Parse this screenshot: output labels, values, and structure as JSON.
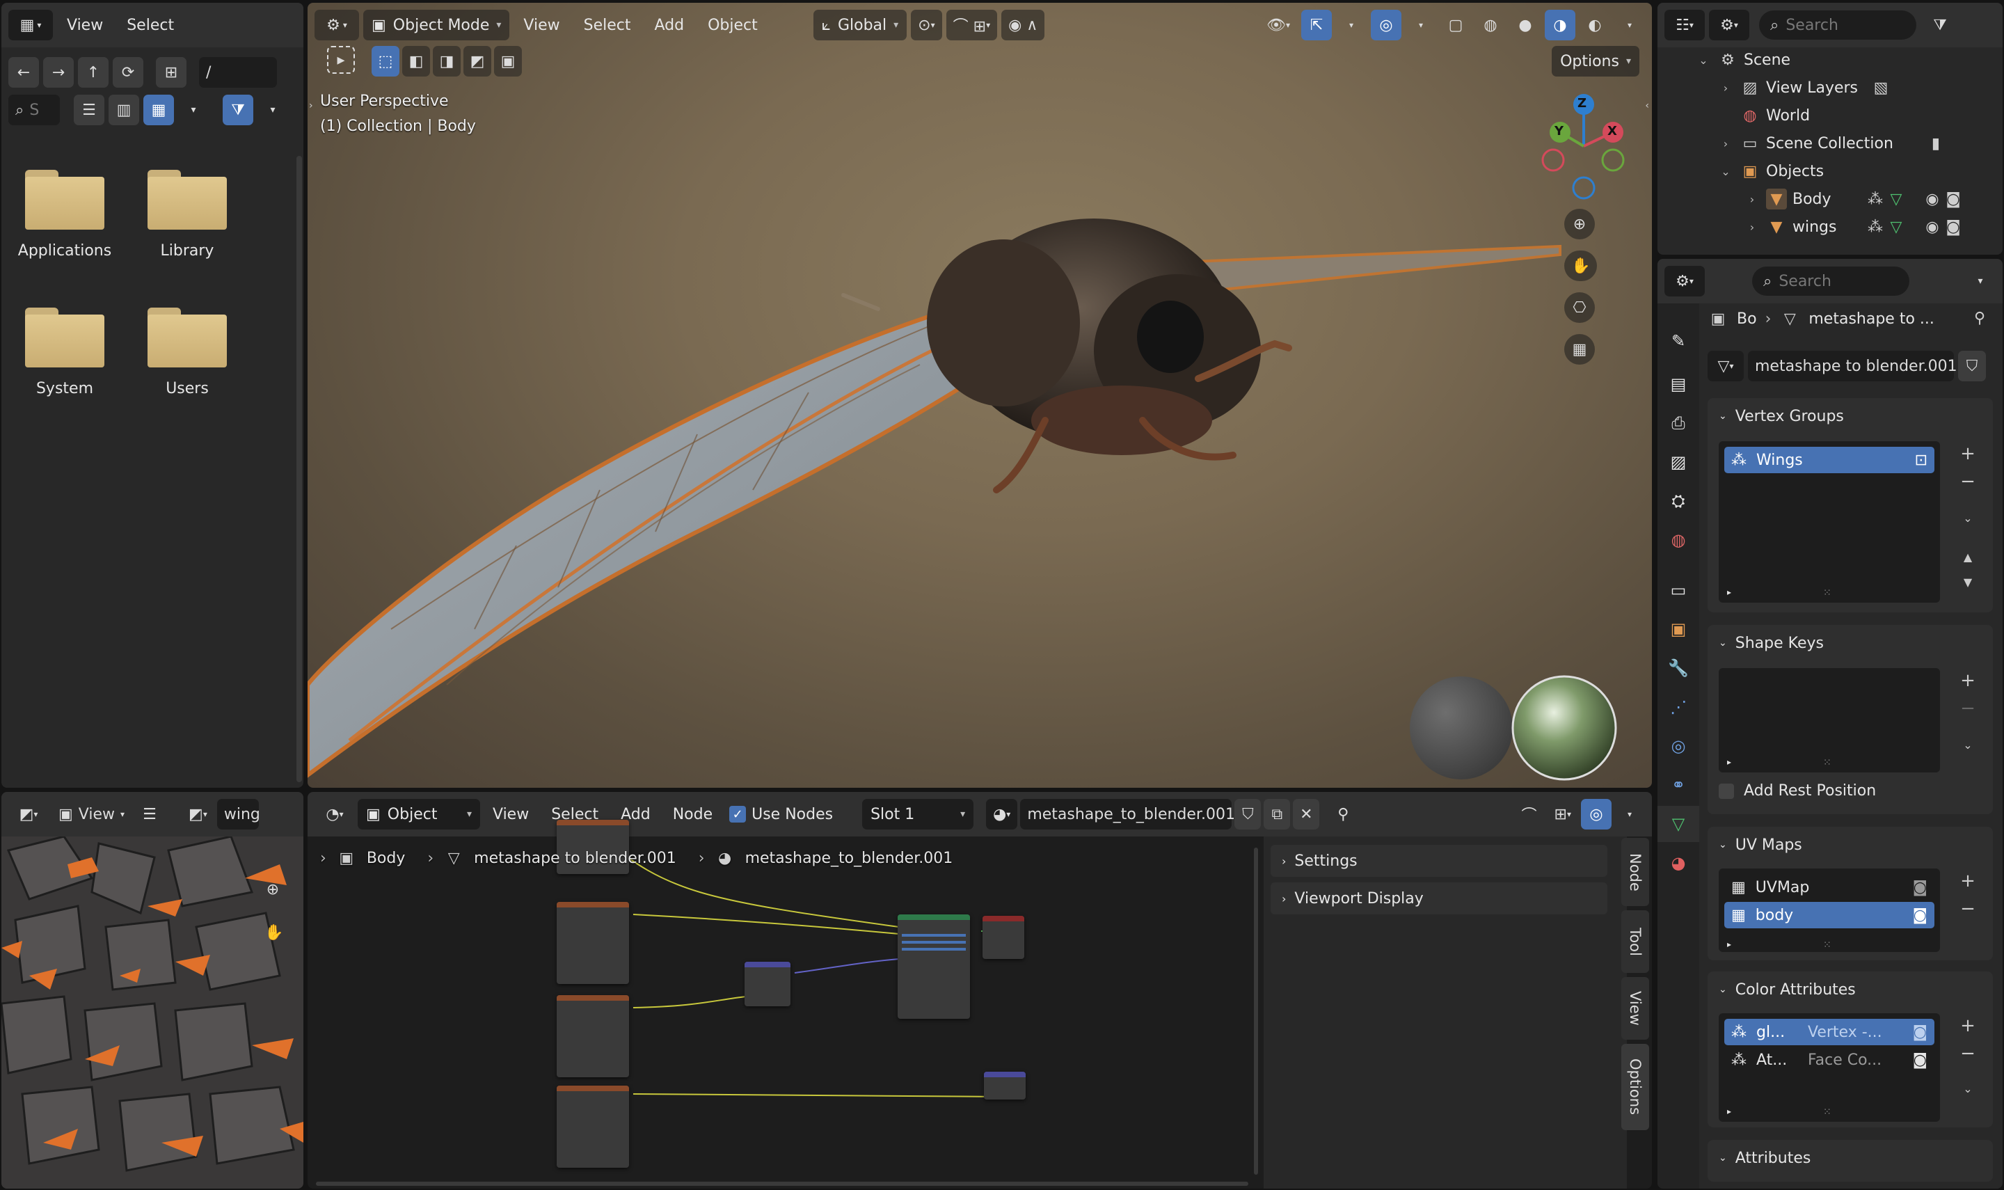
{
  "file_browser": {
    "menus": [
      "View",
      "Select"
    ],
    "path": "/",
    "search_placeholder": "S",
    "folders": [
      "Applications",
      "Library",
      "System",
      "Users"
    ]
  },
  "viewport": {
    "mode": "Object Mode",
    "menus": [
      "View",
      "Select",
      "Add",
      "Object"
    ],
    "orientation": "Global",
    "options_label": "Options",
    "info_line1": "User Perspective",
    "info_line2": "(1) Collection | Body",
    "gizmo": {
      "z": "Z",
      "y": "Y",
      "x": "X"
    }
  },
  "outliner": {
    "search_placeholder": "Search",
    "items": [
      {
        "label": "Scene"
      },
      {
        "label": "View Layers"
      },
      {
        "label": "World"
      },
      {
        "label": "Scene Collection"
      },
      {
        "label": "Objects"
      },
      {
        "label": "Body"
      },
      {
        "label": "wings"
      }
    ]
  },
  "properties": {
    "search_placeholder": "Search",
    "breadcrumb_object": "Bo",
    "breadcrumb_mesh": "metashape to ...",
    "mesh_name": "metashape to blender.001",
    "vertex_groups": {
      "title": "Vertex Groups",
      "items": [
        "Wings"
      ]
    },
    "shape_keys": {
      "title": "Shape Keys"
    },
    "add_rest_position": "Add Rest Position",
    "uv_maps": {
      "title": "UV Maps",
      "items": [
        "UVMap",
        "body"
      ]
    },
    "color_attributes": {
      "title": "Color Attributes",
      "items": [
        {
          "name": "gl...",
          "type": "Vertex -..."
        },
        {
          "name": "At...",
          "type": "Face Co..."
        }
      ]
    },
    "attributes_title": "Attributes"
  },
  "image_editor": {
    "view_label": "View",
    "image_name": "wing"
  },
  "node_editor": {
    "object_dropdown": "Object",
    "menus": [
      "View",
      "Select",
      "Add",
      "Node"
    ],
    "use_nodes_label": "Use Nodes",
    "slot": "Slot 1",
    "material": "metashape_to_blender.001",
    "breadcrumb": [
      "Body",
      "metashape to blender.001",
      "metashape_to_blender.001"
    ],
    "sidebar_panels": [
      "Settings",
      "Viewport Display"
    ],
    "side_tabs": [
      "Node",
      "Tool",
      "View",
      "Options"
    ]
  },
  "colors": {
    "accent": "#4772b3",
    "panel": "#282828",
    "header": "#303030",
    "field": "#1d1d1d",
    "folder": "#d9bd82"
  }
}
